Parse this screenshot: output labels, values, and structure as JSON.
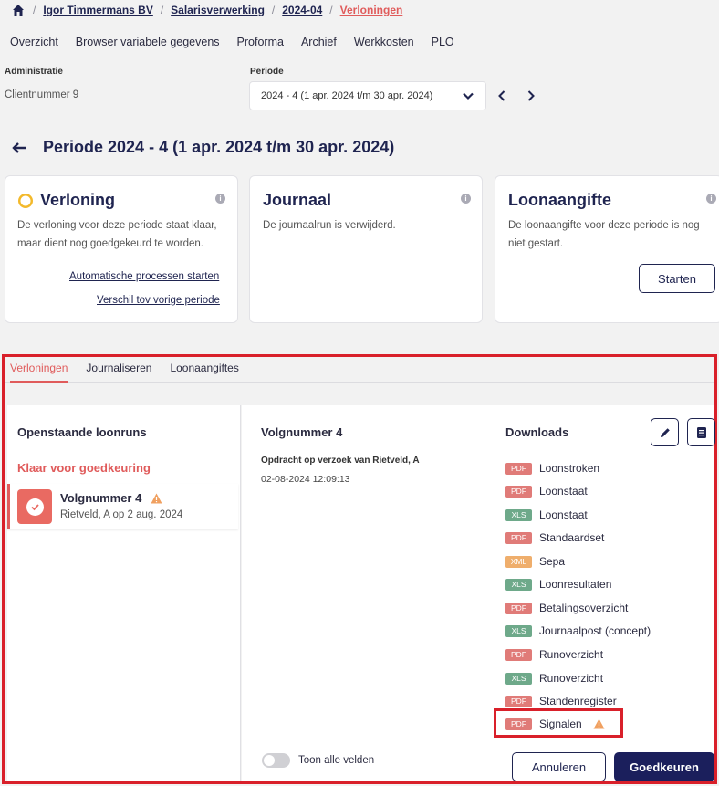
{
  "breadcrumb": {
    "items": [
      "Igor Timmermans BV",
      "Salarisverwerking",
      "2024-04",
      "Verloningen"
    ]
  },
  "topnav": [
    "Overzicht",
    "Browser variabele gegevens",
    "Proforma",
    "Archief",
    "Werkkosten",
    "PLO"
  ],
  "administratie": {
    "label": "Administratie",
    "value": "Clientnummer 9"
  },
  "periode": {
    "label": "Periode",
    "value": "2024 - 4 (1 apr. 2024 t/m 30 apr. 2024)"
  },
  "page_title": "Periode 2024 - 4 (1 apr. 2024 t/m 30 apr. 2024)",
  "cards": {
    "verloning": {
      "title": "Verloning",
      "text": "De verloning voor deze periode staat klaar, maar dient nog goedgekeurd te worden.",
      "link1": "Automatische processen starten",
      "link2": "Verschil tov vorige periode"
    },
    "journaal": {
      "title": "Journaal",
      "text": "De journaalrun is verwijderd."
    },
    "loonaangifte": {
      "title": "Loonaangifte",
      "text": "De loonaangifte voor deze periode is nog niet gestart.",
      "button": "Starten"
    }
  },
  "tabs": [
    "Verloningen",
    "Journaliseren",
    "Loonaangiftes"
  ],
  "left": {
    "title": "Openstaande loonruns",
    "status": "Klaar voor goedkeuring",
    "run": {
      "title": "Volgnummer 4",
      "subtitle": "Rietveld, A op 2 aug. 2024"
    }
  },
  "detail": {
    "title": "Volgnummer 4",
    "requested": "Opdracht op verzoek van Rietveld, A",
    "datetime": "02-08-2024 12:09:13"
  },
  "downloads": {
    "title": "Downloads",
    "items": [
      {
        "type": "PDF",
        "label": "Loonstroken"
      },
      {
        "type": "PDF",
        "label": "Loonstaat"
      },
      {
        "type": "XLS",
        "label": "Loonstaat"
      },
      {
        "type": "PDF",
        "label": "Standaardset"
      },
      {
        "type": "XML",
        "label": "Sepa"
      },
      {
        "type": "XLS",
        "label": "Loonresultaten"
      },
      {
        "type": "PDF",
        "label": "Betalingsoverzicht"
      },
      {
        "type": "XLS",
        "label": "Journaalpost (concept)"
      },
      {
        "type": "PDF",
        "label": "Runoverzicht"
      },
      {
        "type": "XLS",
        "label": "Runoverzicht"
      },
      {
        "type": "PDF",
        "label": "Standenregister"
      },
      {
        "type": "PDF",
        "label": "Signalen"
      }
    ]
  },
  "footer": {
    "toggle_label": "Toon alle velden",
    "cancel": "Annuleren",
    "approve": "Goedkeuren"
  },
  "colors": {
    "accent": "#e05b5b",
    "primary": "#1b1f5c",
    "highlight": "#d9202a"
  }
}
